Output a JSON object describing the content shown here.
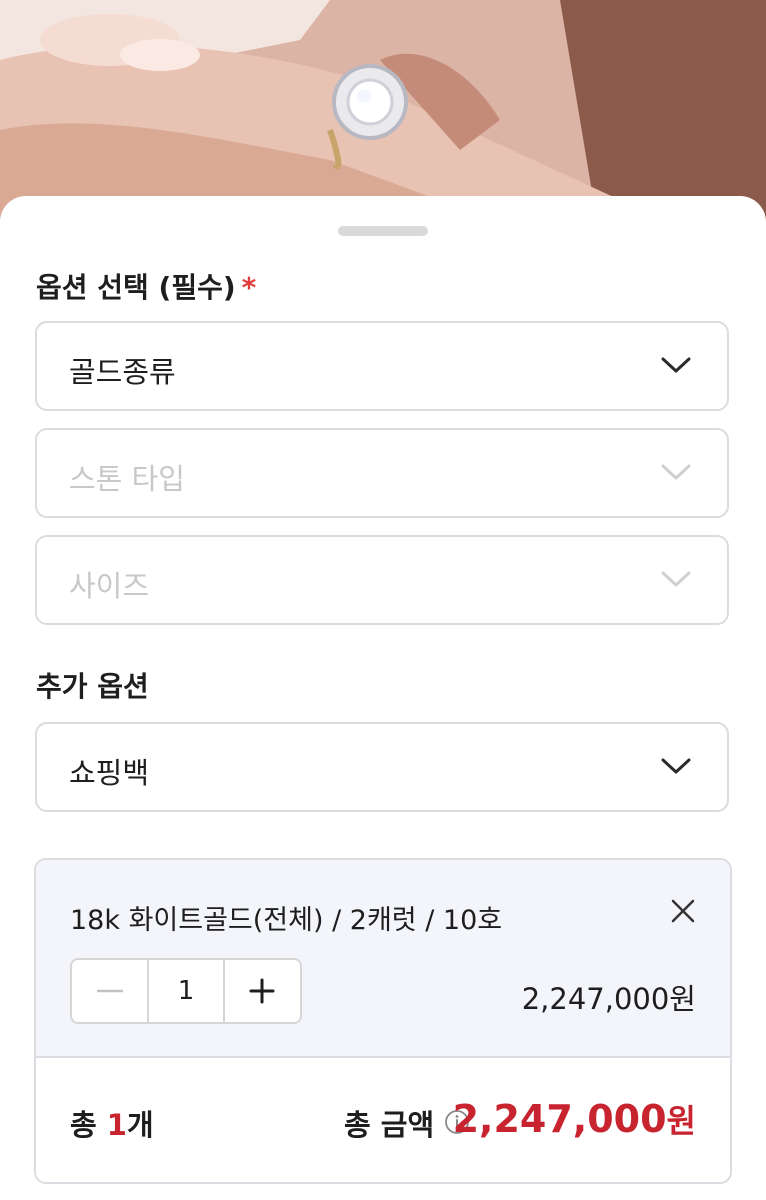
{
  "options": {
    "required_title": "옵션 선택 (필수)",
    "required_mark": "*",
    "selects": [
      {
        "label": "골드종류",
        "enabled": true
      },
      {
        "label": "스톤 타입",
        "enabled": false
      },
      {
        "label": "사이즈",
        "enabled": false
      }
    ]
  },
  "extra": {
    "title": "추가 옵션",
    "select_label": "쇼핑백"
  },
  "cart": {
    "item_name": "18k 화이트골드(전체) / 2캐럿 / 10호",
    "quantity": "1",
    "item_price": "2,247,000원"
  },
  "total": {
    "count_prefix": "총 ",
    "count_value": "1",
    "count_suffix": "개",
    "amount_label": "총 금액",
    "amount_value": "2,247,000",
    "amount_unit": "원"
  },
  "colors": {
    "accent": "#c8242f",
    "required": "#e23b3b",
    "cart_bg": "#f3f5fa"
  },
  "icons": [
    "chevron-down-icon",
    "close-icon",
    "minus-icon",
    "plus-icon",
    "info-icon"
  ]
}
